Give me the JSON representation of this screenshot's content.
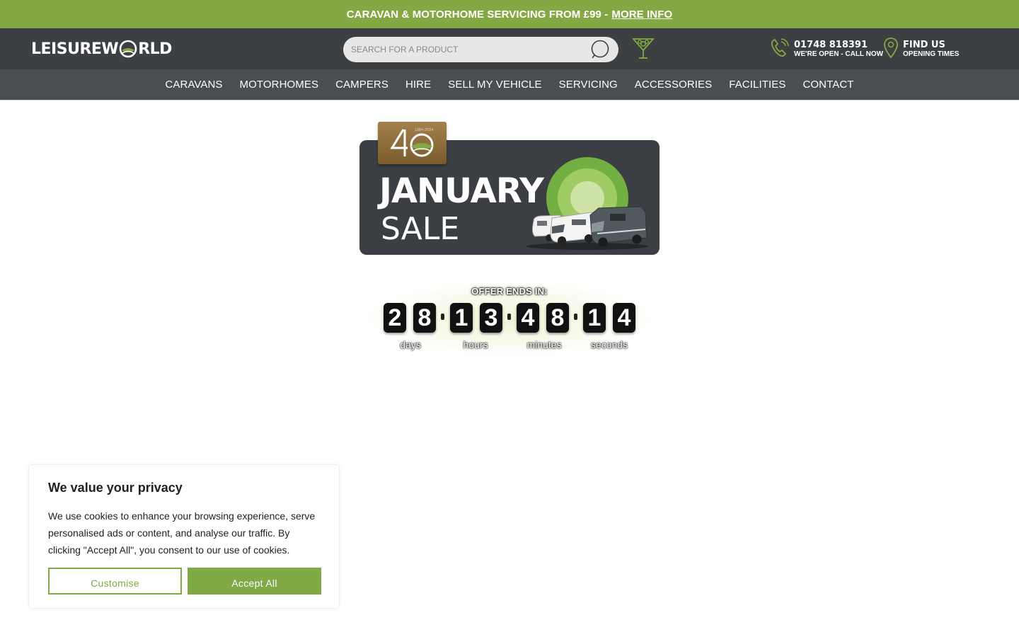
{
  "promo": {
    "text": "CARAVAN & MOTORHOME SERVICING FROM £99 -",
    "link": "MORE INFO",
    "background": "#84a844"
  },
  "header": {
    "logo_text_left": "LEISUREW",
    "logo_text_right": "RLD",
    "search_placeholder": "SEARCH FOR A PRODUCT",
    "phone_number": "01748 818391",
    "phone_sub": "WE'RE OPEN - CALL NOW",
    "find_title": "FIND US",
    "find_sub": "OPENING TIMES",
    "background": "#3c4043",
    "accent": "#84a844"
  },
  "nav": {
    "items": [
      "CARAVANS",
      "MOTORHOMES",
      "CAMPERS",
      "HIRE",
      "SELL MY VEHICLE",
      "SERVICING",
      "ACCESSORIES",
      "FACILITIES",
      "CONTACT"
    ]
  },
  "banner": {
    "badge_number": "40",
    "badge_years": "1984-2024",
    "title_line1": "JANUARY",
    "title_line2": "SALE"
  },
  "countdown": {
    "heading": "OFFER ENDS IN:",
    "digits": [
      "2",
      "8",
      "1",
      "3",
      "4",
      "8",
      "1",
      "4"
    ],
    "units": [
      "days",
      "hours",
      "minutes",
      "seconds"
    ]
  },
  "cookie": {
    "title": "We value your privacy",
    "body": "We use cookies to enhance your browsing experience, serve personalised ads or content, and analyse our traffic. By clicking \"Accept All\", you consent to our use of cookies.",
    "customise_label": "Customise",
    "accept_label": "Accept All",
    "accent": "#7faa45"
  }
}
